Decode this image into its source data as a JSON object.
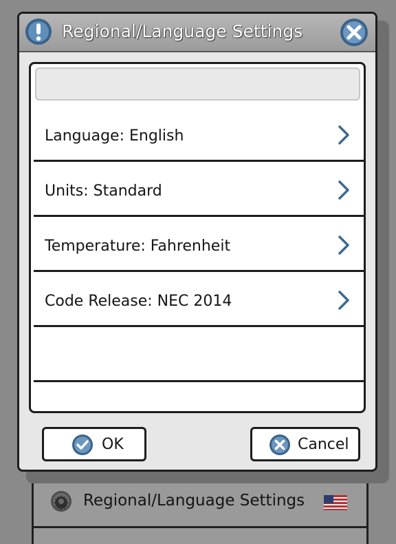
{
  "dialog": {
    "title": "Regional/Language Settings",
    "search": {
      "value": "",
      "placeholder": ""
    },
    "rows": [
      {
        "label": "Language: English"
      },
      {
        "label": "Units: Standard"
      },
      {
        "label": "Temperature: Fahrenheit"
      },
      {
        "label": "Code Release: NEC 2014"
      },
      {
        "label": ""
      },
      {
        "label": ""
      }
    ],
    "ok_label": "OK",
    "cancel_label": "Cancel"
  },
  "background": {
    "row_label": "Regional/Language Settings"
  },
  "icons": {
    "title": "info-alert-icon",
    "close": "close-icon",
    "row_arrow": "chevron-right-icon",
    "ok": "check-circle-icon",
    "cancel": "x-circle-icon",
    "background_row": "gear-icon",
    "flag": "us-flag-icon"
  },
  "colors": {
    "accent_blue": "#3f6f9c",
    "titlebar": "#a9a9a9",
    "dialog_bg": "#e7e7e7",
    "chevron": "#3b6a92"
  }
}
